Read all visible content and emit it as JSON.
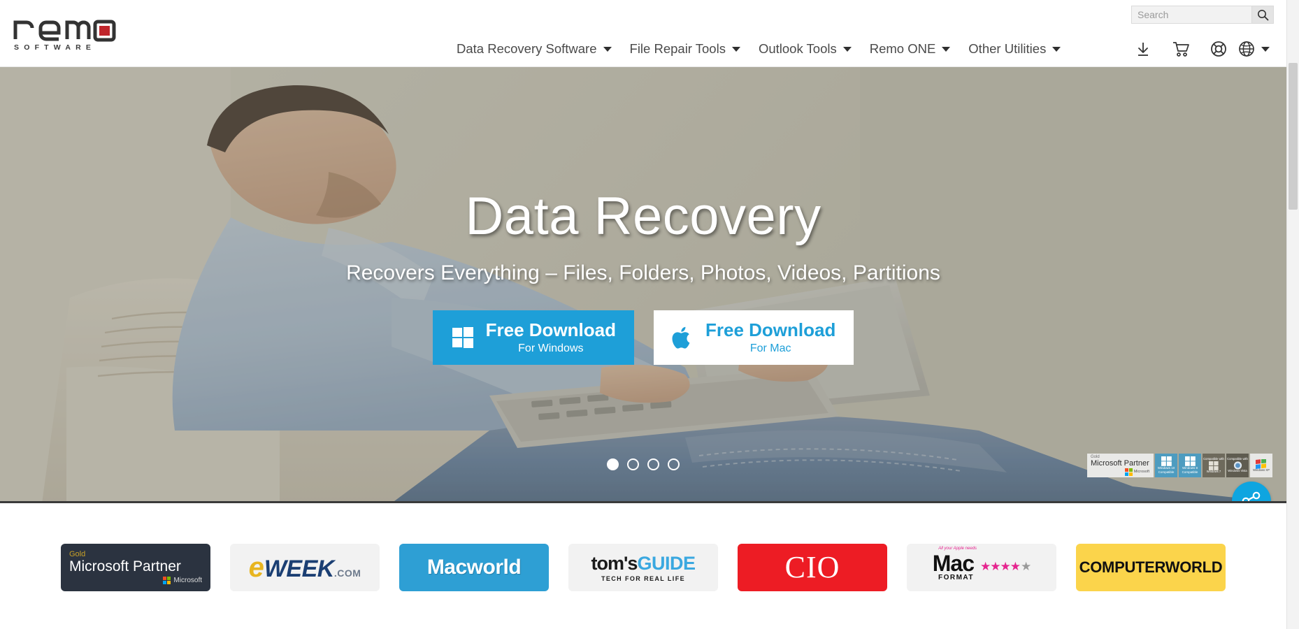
{
  "search": {
    "placeholder": "Search",
    "value": "",
    "icon": "search-icon"
  },
  "brand": {
    "name": "remo",
    "tagline": "SOFTWARE",
    "accent": "#c0252b"
  },
  "nav": {
    "items": [
      {
        "label": "Data Recovery Software",
        "has_dropdown": true
      },
      {
        "label": "File Repair Tools",
        "has_dropdown": true
      },
      {
        "label": "Outlook Tools",
        "has_dropdown": true
      },
      {
        "label": "Remo ONE",
        "has_dropdown": true
      },
      {
        "label": "Other Utilities",
        "has_dropdown": true
      }
    ],
    "icons": [
      {
        "name": "download-icon"
      },
      {
        "name": "shopping-cart-icon"
      },
      {
        "name": "support-lifebuoy-icon"
      },
      {
        "name": "globe-language-icon"
      }
    ]
  },
  "hero": {
    "title": "Data Recovery",
    "subtitle": "Recovers Everything – Files, Folders, Photos, Videos, Partitions",
    "buttons": [
      {
        "icon": "windows-logo-icon",
        "main": "Free Download",
        "sub": "For Windows",
        "style": "primary",
        "color": "#1e9fd8"
      },
      {
        "icon": "apple-logo-icon",
        "main": "Free Download",
        "sub": "For Mac",
        "style": "light",
        "color": "#ffffff"
      }
    ],
    "carousel": {
      "total": 4,
      "active": 1
    },
    "badges": {
      "partner": {
        "gold": "Gold",
        "title": "Microsoft Partner",
        "vendor": "Microsoft"
      },
      "compat": [
        {
          "top": "Windows 10",
          "bottom": "Compatible"
        },
        {
          "top": "Windows 8",
          "bottom": "Compatible"
        },
        {
          "top": "Compatible with",
          "bottom": "Windows 7"
        },
        {
          "top": "Compatible with",
          "bottom": "Windows Vista"
        },
        {
          "top": "",
          "bottom": "Windows XP"
        }
      ]
    },
    "share_button": {
      "name": "share-button",
      "icon": "share-nodes-icon",
      "color": "#0fa5e0"
    }
  },
  "press": {
    "items": [
      {
        "id": "microsoft-partner",
        "gold": "Gold",
        "title": "Microsoft Partner",
        "vendor": "Microsoft"
      },
      {
        "id": "eweek",
        "e": "e",
        "week": "WEEK",
        "com": ".COM"
      },
      {
        "id": "macworld",
        "label": "Macworld"
      },
      {
        "id": "toms-guide",
        "toms": "tom's",
        "guide": "GUIDE",
        "tagline": "TECH FOR REAL LIFE"
      },
      {
        "id": "cio",
        "label": "CIO"
      },
      {
        "id": "macformat",
        "needs": "All your Apple needs",
        "mac": "Mac",
        "format": "FORMAT",
        "rating": 4.5,
        "stars": "★★★★",
        "half_star": "★"
      },
      {
        "id": "computerworld",
        "label": "COMPUTERWORLD"
      }
    ]
  }
}
